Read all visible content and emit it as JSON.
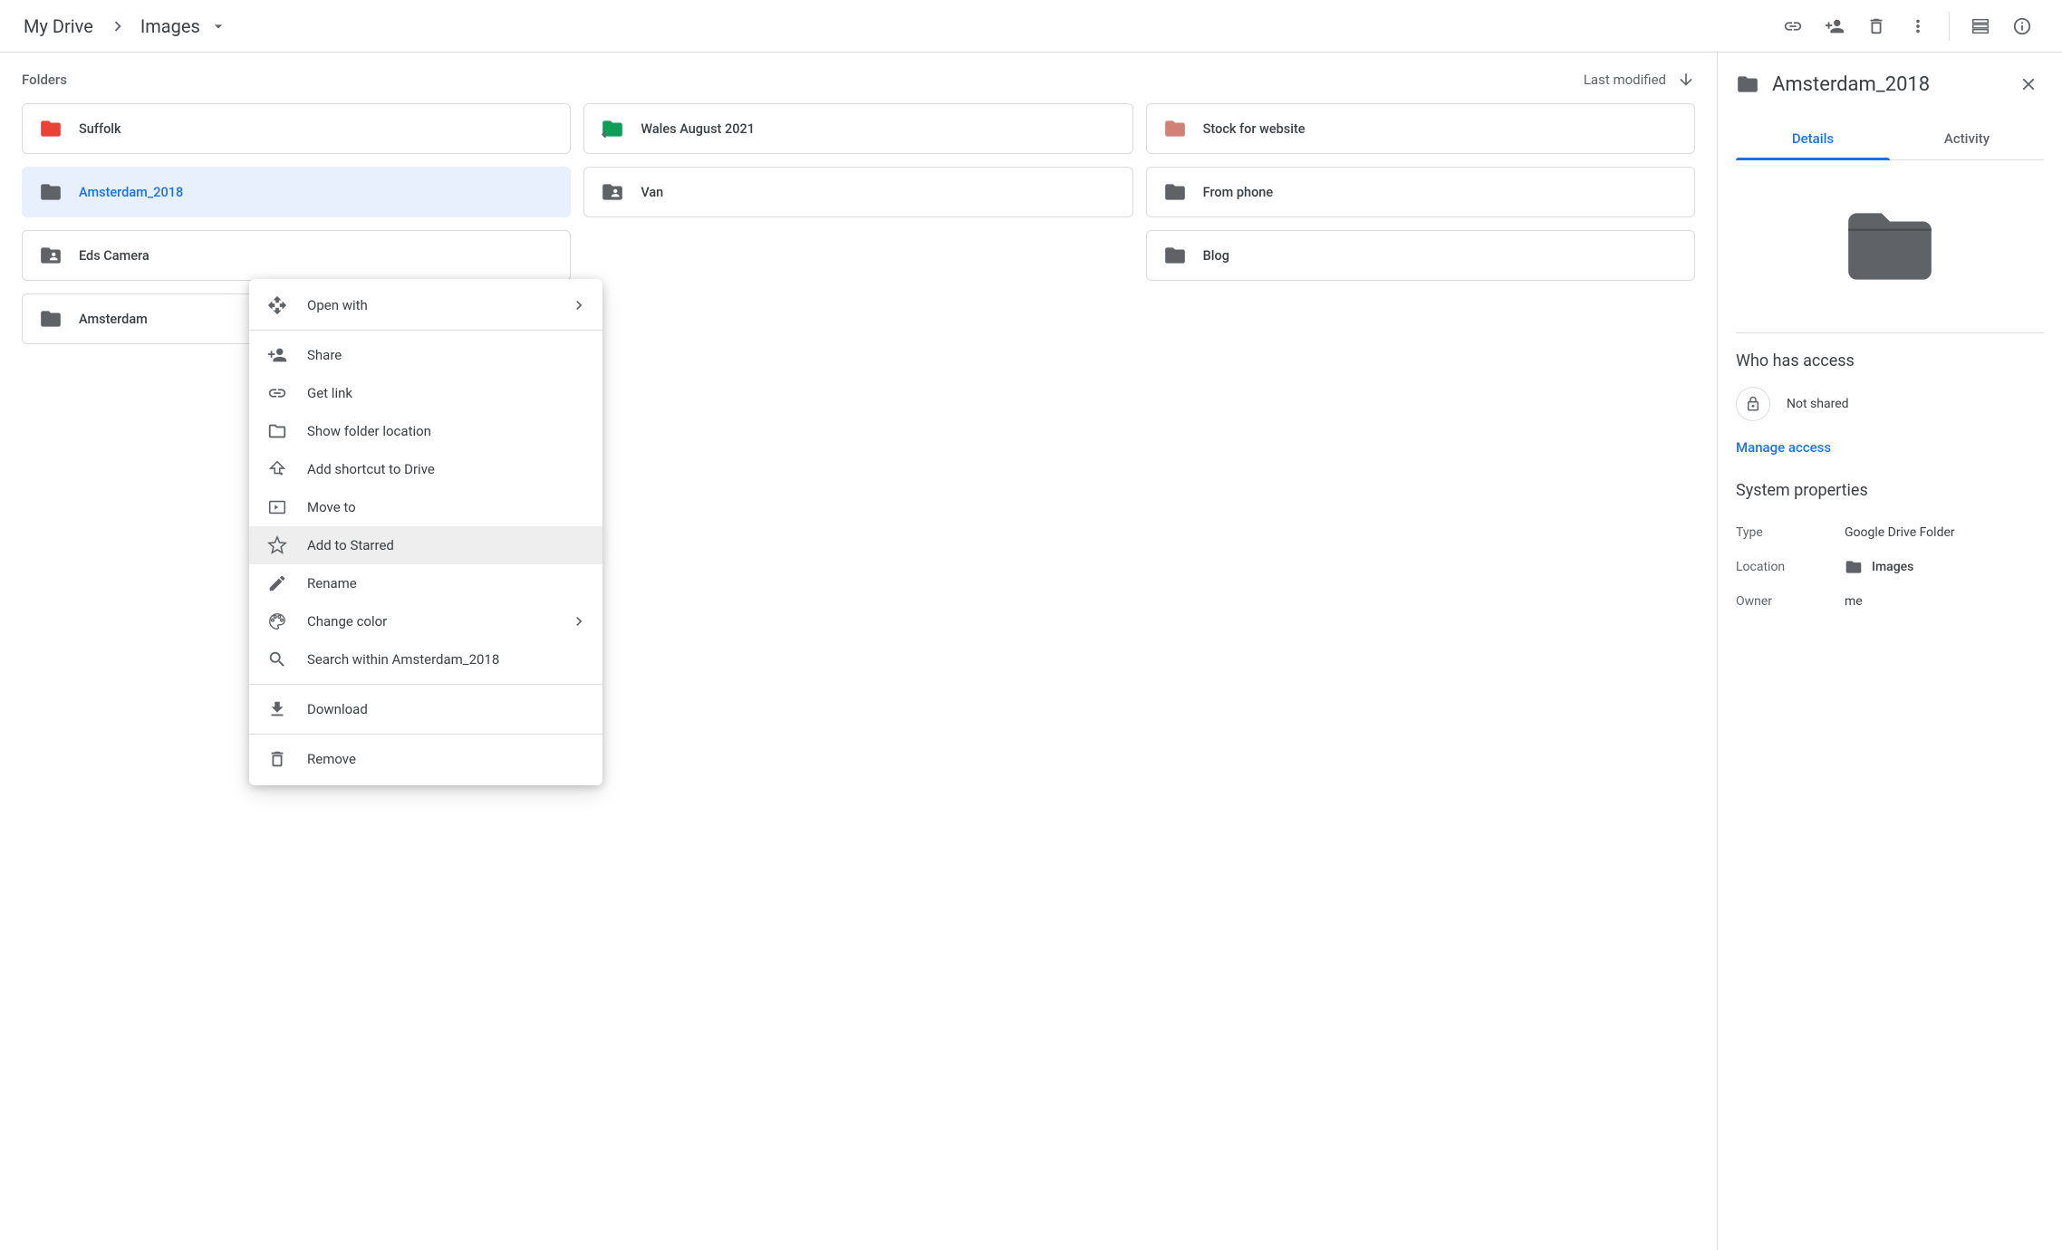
{
  "breadcrumb": {
    "root": "My Drive",
    "current": "Images"
  },
  "section": {
    "folders_label": "Folders",
    "sort_label": "Last modified"
  },
  "folders": [
    {
      "name": "Suffolk",
      "icon_color": "#ea4335",
      "type": "folder"
    },
    {
      "name": "Wales August 2021",
      "icon_color": "#0f9d58",
      "type": "shortcut"
    },
    {
      "name": "Stock for website",
      "icon_color": "#d28177",
      "type": "folder"
    },
    {
      "name": "Amsterdam_2018",
      "icon_color": "#5f6368",
      "type": "folder",
      "selected": true
    },
    {
      "name": "Van",
      "icon_color": "#5f6368",
      "type": "shared"
    },
    {
      "name": "From phone",
      "icon_color": "#5f6368",
      "type": "folder"
    },
    {
      "name": "Eds Camera",
      "icon_color": "#5f6368",
      "type": "shared"
    },
    {
      "name": "",
      "icon_color": "",
      "type": "placeholder"
    },
    {
      "name": "Blog",
      "icon_color": "#5f6368",
      "type": "folder"
    },
    {
      "name": "Amsterdam",
      "icon_color": "#5f6368",
      "type": "folder"
    }
  ],
  "context_menu": {
    "open_with": "Open with",
    "share": "Share",
    "get_link": "Get link",
    "show_location": "Show folder location",
    "add_shortcut": "Add shortcut to Drive",
    "move_to": "Move to",
    "add_starred": "Add to Starred",
    "rename": "Rename",
    "change_color": "Change color",
    "search_within": "Search within Amsterdam_2018",
    "download": "Download",
    "remove": "Remove"
  },
  "details": {
    "title": "Amsterdam_2018",
    "tabs": {
      "details": "Details",
      "activity": "Activity"
    },
    "access_title": "Who has access",
    "not_shared": "Not shared",
    "manage_access": "Manage access",
    "system_props_title": "System properties",
    "type_label": "Type",
    "type_value": "Google Drive Folder",
    "location_label": "Location",
    "location_value": "Images",
    "owner_label": "Owner",
    "owner_value": "me"
  }
}
